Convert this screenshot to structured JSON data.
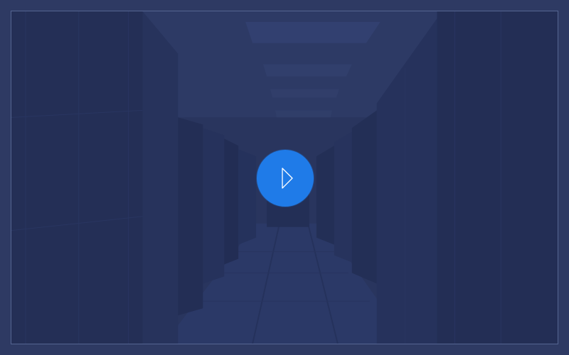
{
  "video": {
    "poster_subject": "server-racks-corridor",
    "tint_color": "#2e3a63",
    "play_button": {
      "color": "#1f7be8",
      "icon": "play-icon"
    }
  }
}
